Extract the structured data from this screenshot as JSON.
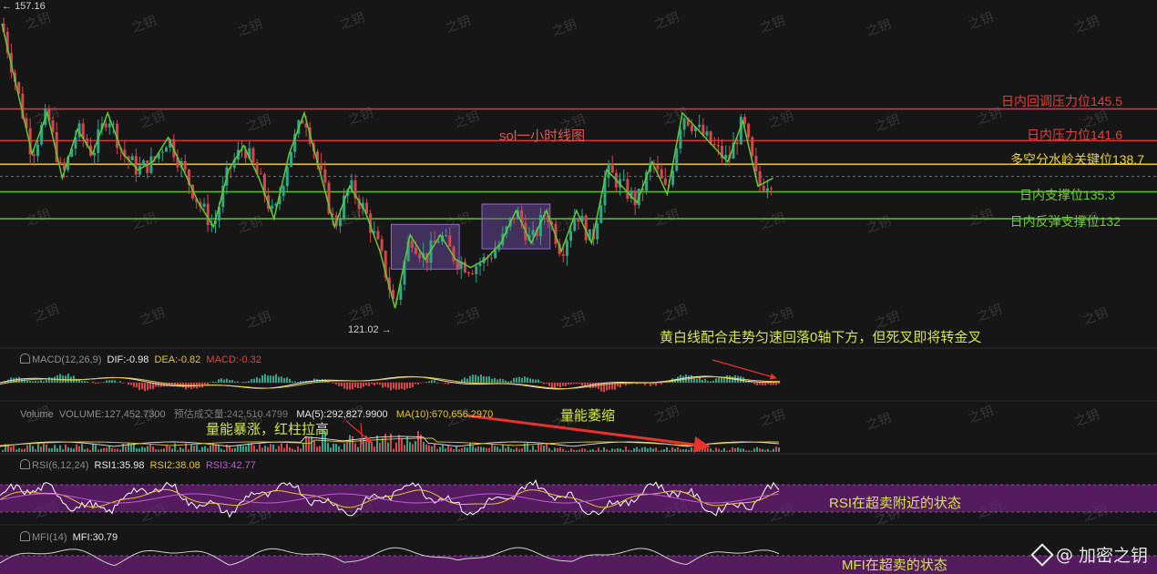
{
  "chart_data": {
    "type": "line",
    "title": "sol一小时线图",
    "price_high": "157.16",
    "price_low": "121.02",
    "ylim": [
      118,
      158
    ],
    "levels": [
      {
        "name": "日内回调压力位145.5",
        "value": 145.5,
        "color": "#d9353b"
      },
      {
        "name": "日内压力位141.6",
        "value": 141.6,
        "color": "#d9353b"
      },
      {
        "name": "多空分水岭关键位138.7",
        "value": 138.7,
        "color": "#e6c62f"
      },
      {
        "name": "日内支撑位135.3",
        "value": 135.3,
        "color": "#5fb333"
      },
      {
        "name": "日内反弹支撑位132",
        "value": 132,
        "color": "#5fb333"
      }
    ],
    "dashed_level": 137.2,
    "zigzag": [
      {
        "t": 0,
        "p": 156
      },
      {
        "t": 4,
        "p": 148
      },
      {
        "t": 8,
        "p": 140
      },
      {
        "t": 12,
        "p": 145
      },
      {
        "t": 16,
        "p": 137
      },
      {
        "t": 20,
        "p": 143
      },
      {
        "t": 24,
        "p": 140
      },
      {
        "t": 28,
        "p": 145
      },
      {
        "t": 32,
        "p": 140
      },
      {
        "t": 36,
        "p": 138
      },
      {
        "t": 40,
        "p": 139
      },
      {
        "t": 44,
        "p": 142
      },
      {
        "t": 48,
        "p": 138
      },
      {
        "t": 52,
        "p": 134
      },
      {
        "t": 56,
        "p": 131
      },
      {
        "t": 60,
        "p": 138
      },
      {
        "t": 64,
        "p": 141
      },
      {
        "t": 68,
        "p": 137
      },
      {
        "t": 72,
        "p": 132
      },
      {
        "t": 76,
        "p": 140
      },
      {
        "t": 80,
        "p": 145
      },
      {
        "t": 84,
        "p": 138
      },
      {
        "t": 88,
        "p": 131
      },
      {
        "t": 92,
        "p": 136
      },
      {
        "t": 96,
        "p": 133
      },
      {
        "t": 100,
        "p": 128
      },
      {
        "t": 104,
        "p": 121
      },
      {
        "t": 108,
        "p": 130
      },
      {
        "t": 112,
        "p": 127
      },
      {
        "t": 116,
        "p": 130
      },
      {
        "t": 120,
        "p": 127
      },
      {
        "t": 124,
        "p": 126
      },
      {
        "t": 128,
        "p": 127
      },
      {
        "t": 132,
        "p": 129
      },
      {
        "t": 136,
        "p": 133
      },
      {
        "t": 140,
        "p": 129
      },
      {
        "t": 144,
        "p": 133
      },
      {
        "t": 148,
        "p": 128
      },
      {
        "t": 152,
        "p": 133
      },
      {
        "t": 156,
        "p": 129
      },
      {
        "t": 160,
        "p": 138
      },
      {
        "t": 164,
        "p": 136
      },
      {
        "t": 168,
        "p": 134
      },
      {
        "t": 172,
        "p": 139
      },
      {
        "t": 176,
        "p": 135
      },
      {
        "t": 180,
        "p": 145
      },
      {
        "t": 184,
        "p": 143
      },
      {
        "t": 188,
        "p": 141
      },
      {
        "t": 192,
        "p": 139
      },
      {
        "t": 196,
        "p": 144
      },
      {
        "t": 200,
        "p": 136
      },
      {
        "t": 204,
        "p": 137
      }
    ],
    "boxes": [
      {
        "t0": 103,
        "t1": 121,
        "p0": 125.8,
        "p1": 131.3
      },
      {
        "t0": 127,
        "t1": 145,
        "p0": 128.3,
        "p1": 133.8
      }
    ]
  },
  "annotations": {
    "macd_note": "黄白线配合走势匀速回落0轴下方，但死叉即将转金叉",
    "volume_shrink": "量能萎缩",
    "volume_surge": "量能暴涨，红柱拉高",
    "rsi_note": "RSI在超卖附近的状态",
    "mfi_note": "MFI在超卖的状态"
  },
  "indicators": {
    "macd": {
      "label": "MACD(12,26,9)",
      "dif": "DIF:-0.98",
      "dea": "DEA:-0.82",
      "macd": "MACD:-0.32"
    },
    "volume": {
      "label": "Volume",
      "vol": "VOLUME:127,452.7300",
      "est": "预估成交量:242,510.4799",
      "ma5": "MA(5):292,827.9900",
      "ma10": "MA(10):670,656.2970"
    },
    "rsi": {
      "label": "RSI(6,12,24)",
      "rsi1": "RSI1:35.98",
      "rsi2": "RSI2:38.08",
      "rsi3": "RSI3:42.77"
    },
    "mfi": {
      "label": "MFI(14)",
      "mfi": "MFI:30.79"
    }
  },
  "watermark": "之钥",
  "brand": {
    "at": "@",
    "name": "加密之钥"
  },
  "colors": {
    "up": "#2ea68a",
    "down": "#d6474d",
    "zigzag": "#5fcc35",
    "box": "#6b4aa0",
    "band": "#6a1f78",
    "rsi1": "#ffffff",
    "rsi2": "#e6c62f",
    "rsi3": "#c05ad6"
  }
}
